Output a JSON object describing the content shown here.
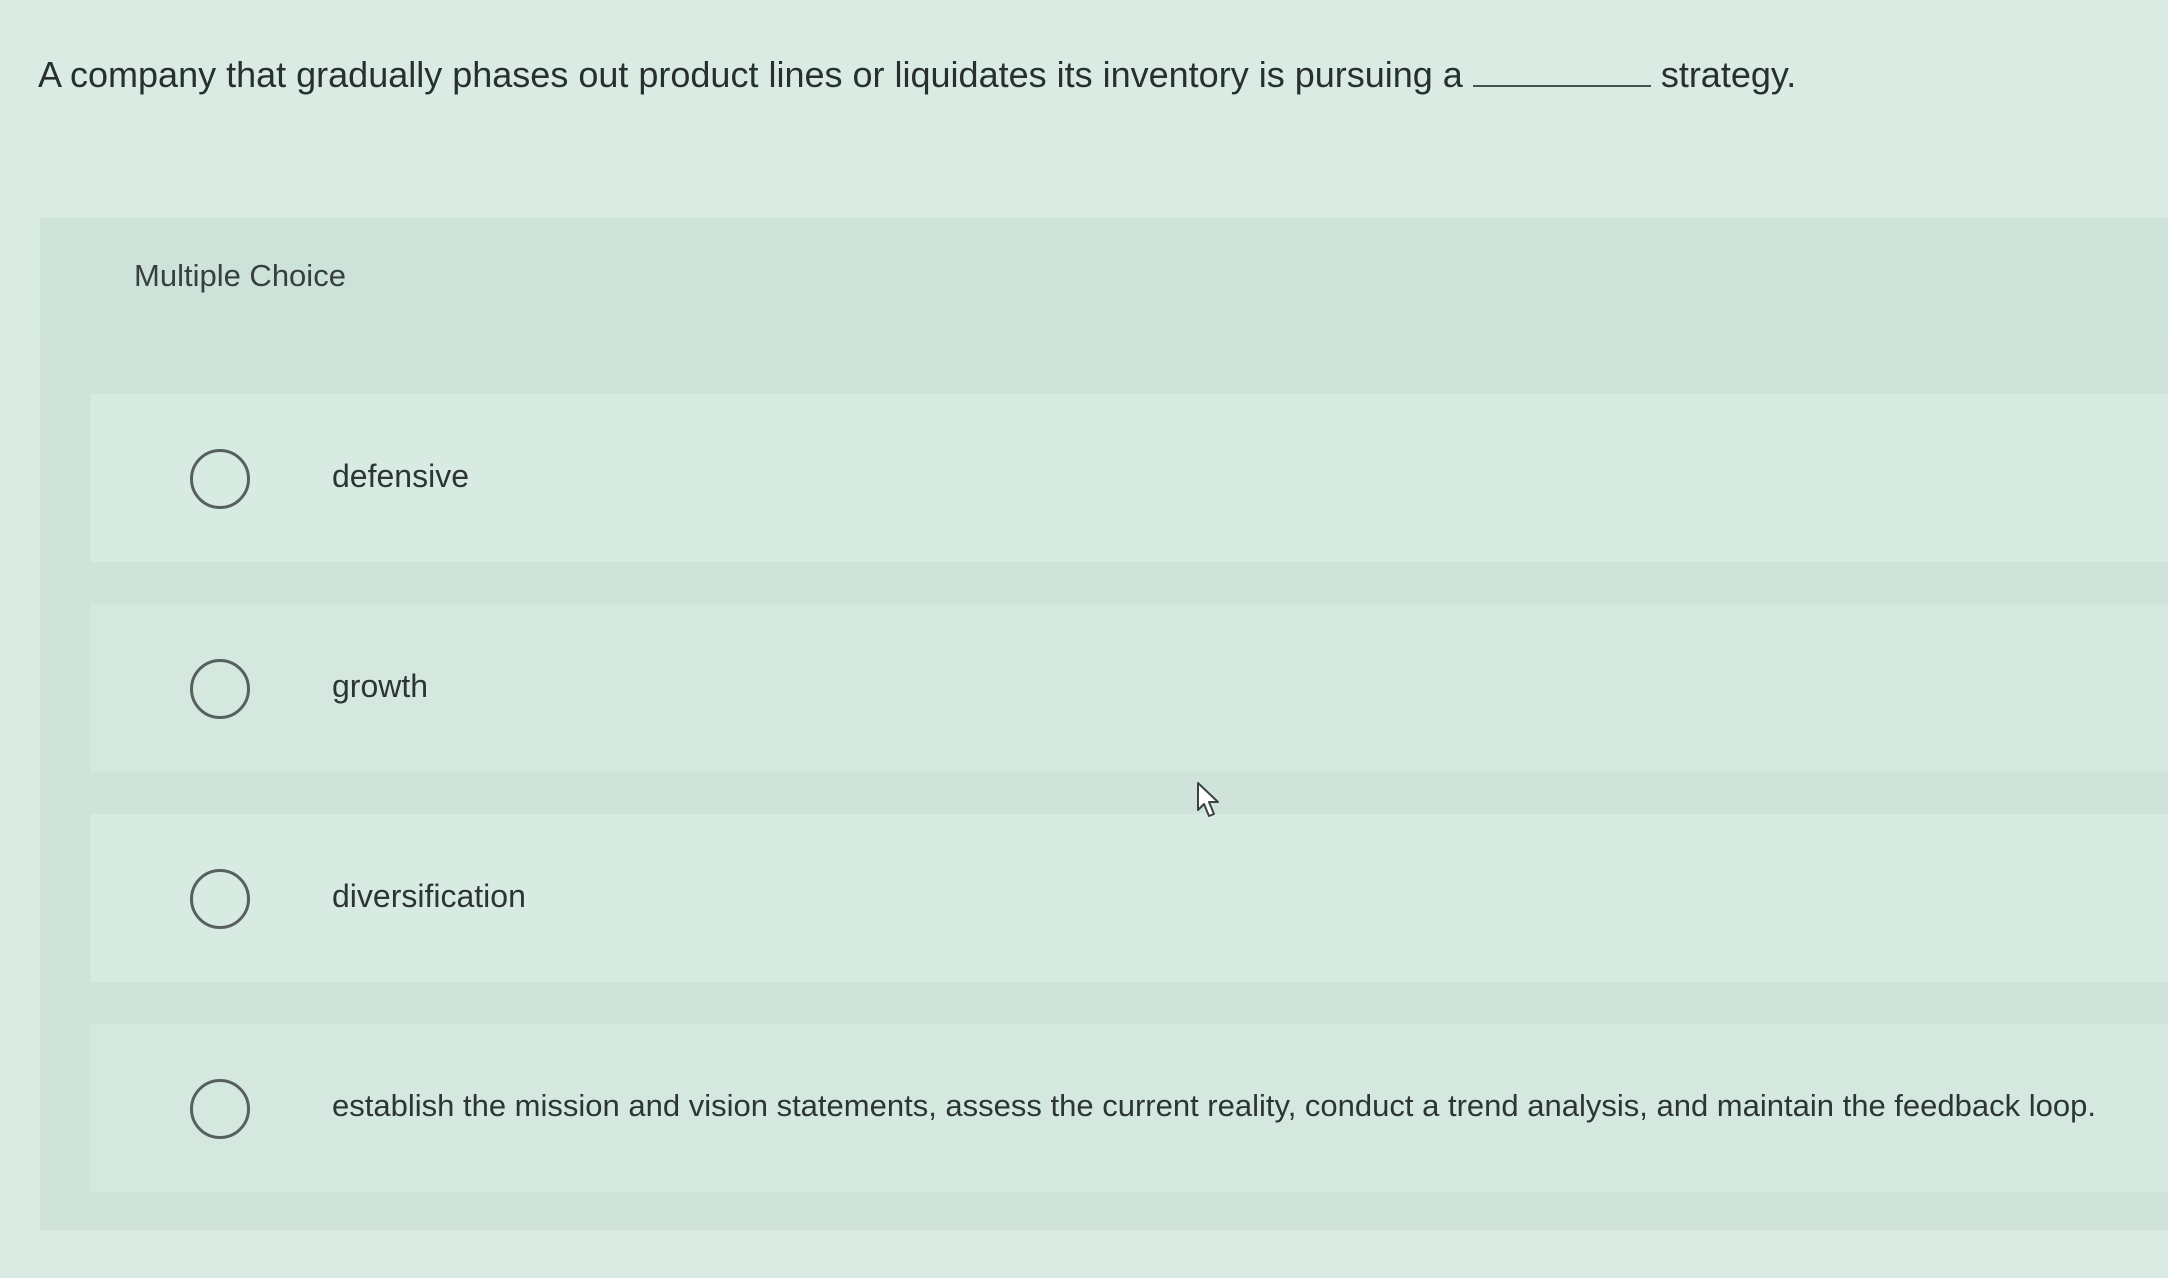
{
  "question": {
    "before_blank": "A company that gradually phases out product lines or liquidates its inventory is pursuing a",
    "after_blank": "strategy."
  },
  "section": {
    "title": "Multiple Choice"
  },
  "choices": [
    {
      "label": "defensive"
    },
    {
      "label": "growth"
    },
    {
      "label": "diversification"
    },
    {
      "label": "establish the mission and vision statements, assess the current reality, conduct a trend analysis, and maintain the feedback loop."
    }
  ],
  "icons": {
    "cursor": "arrow-cursor-icon",
    "radio": "radio-circle-icon"
  }
}
